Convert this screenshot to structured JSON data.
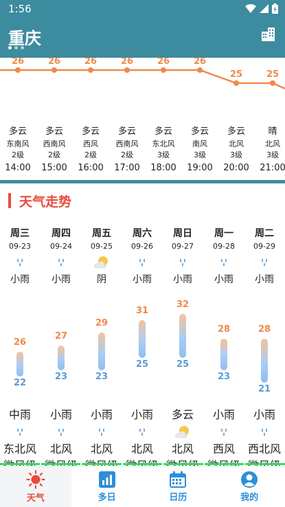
{
  "status": {
    "time": "1:56"
  },
  "header": {
    "city": "重庆"
  },
  "hourly": [
    {
      "temp": "26",
      "cond": "多云",
      "wind": "东南风",
      "level": "2级",
      "time": "14:00"
    },
    {
      "temp": "26",
      "cond": "多云",
      "wind": "西南风",
      "level": "2级",
      "time": "15:00"
    },
    {
      "temp": "26",
      "cond": "多云",
      "wind": "西风",
      "level": "2级",
      "time": "16:00"
    },
    {
      "temp": "26",
      "cond": "多云",
      "wind": "西南风",
      "level": "2级",
      "time": "17:00"
    },
    {
      "temp": "26",
      "cond": "多云",
      "wind": "东北风",
      "level": "3级",
      "time": "18:00"
    },
    {
      "temp": "26",
      "cond": "多云",
      "wind": "南风",
      "level": "3级",
      "time": "19:00"
    },
    {
      "temp": "25",
      "cond": "多云",
      "wind": "北风",
      "level": "3级",
      "time": "20:00"
    },
    {
      "temp": "25",
      "cond": "晴",
      "wind": "北风",
      "level": "3级",
      "time": "21:00"
    }
  ],
  "trend": {
    "title": "天气走势"
  },
  "days": [
    {
      "week": "周三",
      "date": "09-23",
      "day_icon": "rain-icon",
      "day_cond": "小雨",
      "high": "26",
      "low": "22",
      "night_cond": "中雨",
      "night_icon": "rain-icon",
      "wind": "东北风",
      "wind_level": "微风级"
    },
    {
      "week": "周四",
      "date": "09-24",
      "day_icon": "rain-icon",
      "day_cond": "小雨",
      "high": "27",
      "low": "23",
      "night_cond": "小雨",
      "night_icon": "rain-icon",
      "wind": "北风",
      "wind_level": "微风级"
    },
    {
      "week": "周五",
      "date": "09-25",
      "day_icon": "cloudy-sun-icon",
      "day_cond": "阴",
      "high": "29",
      "low": "23",
      "night_cond": "小雨",
      "night_icon": "rain-icon",
      "wind": "北风",
      "wind_level": "微风级"
    },
    {
      "week": "周六",
      "date": "09-26",
      "day_icon": "rain-icon",
      "day_cond": "小雨",
      "high": "31",
      "low": "25",
      "night_cond": "小雨",
      "night_icon": "rain-icon",
      "wind": "北风",
      "wind_level": "微风级"
    },
    {
      "week": "周日",
      "date": "09-27",
      "day_icon": "rain-icon",
      "day_cond": "小雨",
      "high": "32",
      "low": "25",
      "night_cond": "多云",
      "night_icon": "cloudy-sun-icon",
      "wind": "北风",
      "wind_level": "微风级"
    },
    {
      "week": "周一",
      "date": "09-28",
      "day_icon": "rain-icon",
      "day_cond": "小雨",
      "high": "28",
      "low": "23",
      "night_cond": "小雨",
      "night_icon": "rain-icon",
      "wind": "西风",
      "wind_level": "微风级"
    },
    {
      "week": "周二",
      "date": "09-29",
      "day_icon": "rain-icon",
      "day_cond": "小雨",
      "high": "28",
      "low": "21",
      "night_cond": "小雨",
      "night_icon": "rain-icon",
      "wind": "西北风",
      "wind_level": "微风级"
    }
  ],
  "nav": [
    {
      "label": "天气",
      "icon": "sun-icon",
      "active": true
    },
    {
      "label": "多日",
      "icon": "bar-chart-icon",
      "active": false
    },
    {
      "label": "日历",
      "icon": "calendar-icon",
      "active": false
    },
    {
      "label": "我的",
      "icon": "user-icon",
      "active": false
    }
  ],
  "colors": {
    "header": "#3d8b9e",
    "accent_red": "#e94b3c",
    "high_temp": "#f0894a",
    "low_temp": "#5b9bd5",
    "nav_blue": "#2c8fd8",
    "green_line": "#2ee05a"
  }
}
